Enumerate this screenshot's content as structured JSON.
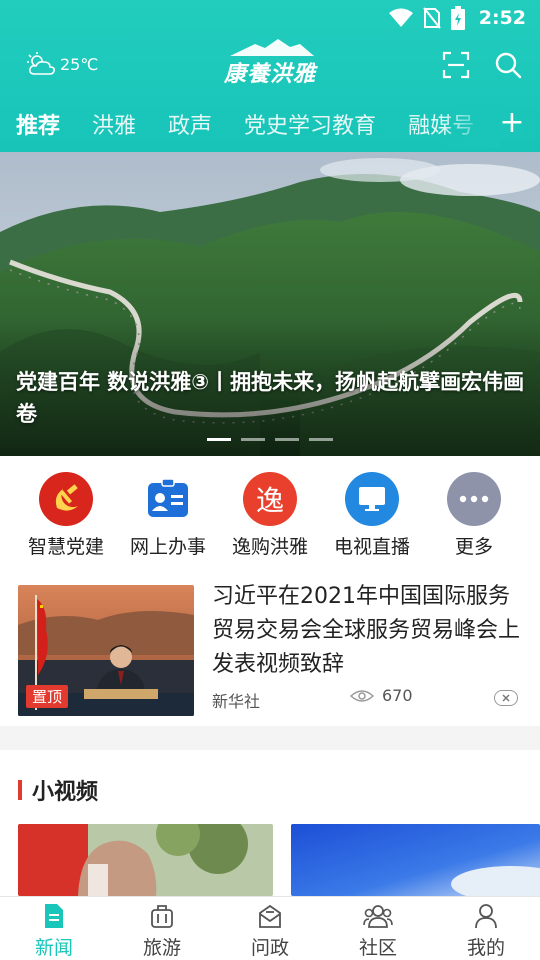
{
  "status_bar": {
    "time": "2:52"
  },
  "weather": {
    "temperature": "25℃",
    "icon": "partly-cloudy-icon"
  },
  "logo": {
    "text": "康養洪雅"
  },
  "tabs": [
    {
      "label": "推荐",
      "active": true
    },
    {
      "label": "洪雅",
      "active": false
    },
    {
      "label": "政声",
      "active": false
    },
    {
      "label": "党史学习教育",
      "active": false
    },
    {
      "label": "融媒号",
      "active": false
    }
  ],
  "tab_add": "+",
  "banner": {
    "title": "党建百年 数说洪雅③丨拥抱未来，扬帆起航擘画宏伟画卷",
    "slide_count": 4,
    "active_slide": 1
  },
  "quick_links": [
    {
      "label": "智慧党建",
      "icon": "party-emblem-icon",
      "color": "#d9261c"
    },
    {
      "label": "网上办事",
      "icon": "id-card-icon",
      "color": "#1e6fd8"
    },
    {
      "label": "逸购洪雅",
      "icon": "yi-char-icon",
      "color": "#e8402d"
    },
    {
      "label": "电视直播",
      "icon": "tv-icon",
      "color": "#2288e0"
    },
    {
      "label": "更多",
      "icon": "more-dots-icon",
      "color": "#8e93aa"
    }
  ],
  "quick_yi_char": "逸",
  "news": {
    "title": "习近平在2021年中国国际服务贸易交易会全球服务贸易峰会上发表视频致辞",
    "badge": "置顶",
    "source": "新华社",
    "views": "670"
  },
  "short_video": {
    "title": "小视频"
  },
  "bottom_nav": [
    {
      "label": "新闻",
      "icon": "news-icon",
      "active": true
    },
    {
      "label": "旅游",
      "icon": "luggage-icon",
      "active": false
    },
    {
      "label": "问政",
      "icon": "mail-icon",
      "active": false
    },
    {
      "label": "社区",
      "icon": "community-icon",
      "active": false
    },
    {
      "label": "我的",
      "icon": "profile-icon",
      "active": false
    }
  ],
  "colors": {
    "accent": "#19c6b9",
    "red": "#e23a2e"
  }
}
